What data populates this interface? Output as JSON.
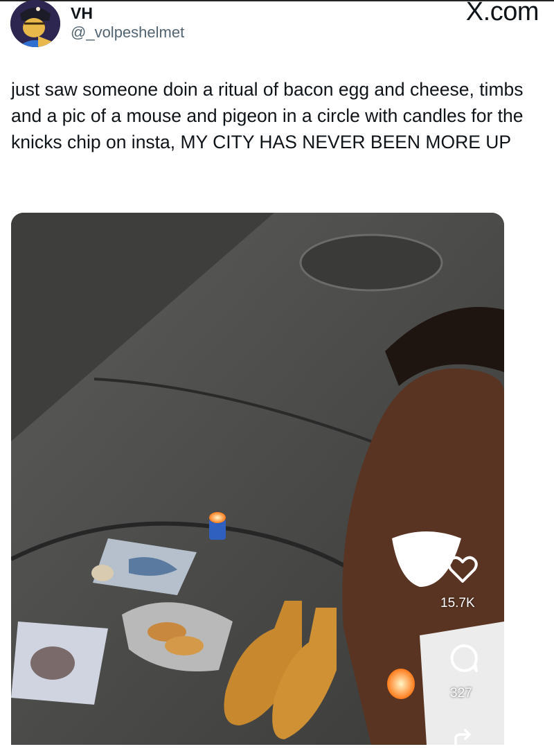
{
  "post": {
    "display_name": "VH",
    "handle": "@_volpeshelmet",
    "brand": "X.com",
    "text": "just saw someone doin a ritual of bacon egg and cheese, timbs and a pic of a mouse and pigeon in a circle with candles for the knicks chip on insta, MY CITY HAS NEVER BEEN MORE UP"
  },
  "media": {
    "likes": "15.7K",
    "comments": "327",
    "icons": [
      "heart-icon",
      "comment-icon",
      "share-icon"
    ]
  },
  "colors": {
    "text": "#0f1419",
    "handle": "#536471",
    "overlay_text": "#ffffff"
  }
}
